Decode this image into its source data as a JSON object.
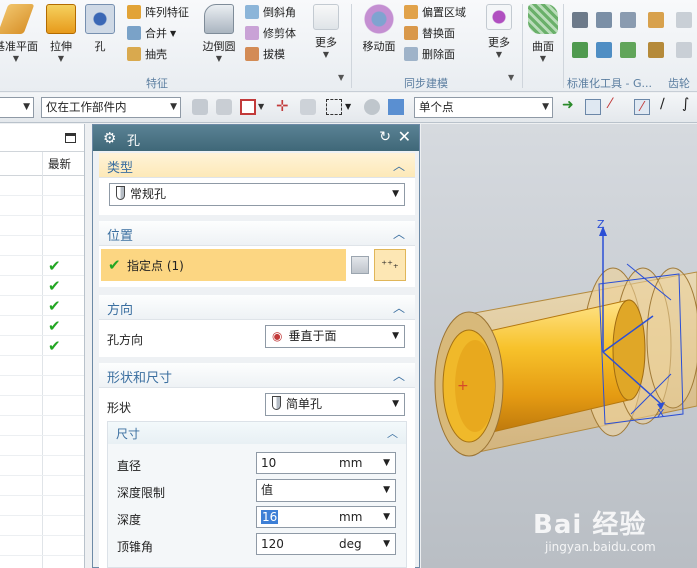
{
  "ribbon": {
    "big_buttons": [
      {
        "label": "基准平面"
      },
      {
        "label": "拉伸"
      },
      {
        "label": "孔"
      },
      {
        "label": "边倒圆"
      },
      {
        "label": "更多"
      },
      {
        "label": "移动面"
      },
      {
        "label": "更多"
      },
      {
        "label": "曲面"
      }
    ],
    "small_buttons": {
      "array_feature": "阵列特征",
      "combine": "合并",
      "shell": "抽壳",
      "chamfer": "倒斜角",
      "trim_body": "修剪体",
      "draft": "拔模",
      "offset_region": "偏置区域",
      "replace_face": "替换面",
      "delete_face": "删除面"
    },
    "groups": {
      "feature": "特征",
      "sync_modeling": "同步建模",
      "std_tools": "标准化工具 - G...",
      "gear": "齿轮"
    }
  },
  "selection_bar": {
    "filter_value": "仅在工作部件内",
    "snap_value": "单个点"
  },
  "navigator": {
    "column_header": "最新",
    "check_mark": "✔"
  },
  "dialog": {
    "title": "孔",
    "sections": {
      "type": {
        "title": "类型",
        "value": "常规孔"
      },
      "position": {
        "title": "位置",
        "specify_point": "指定点 (1)"
      },
      "direction": {
        "title": "方向",
        "label": "孔方向",
        "value": "垂直于面"
      },
      "shape": {
        "title": "形状和尺寸",
        "shape_label": "形状",
        "shape_value": "简单孔",
        "dimensions_title": "尺寸",
        "diameter_label": "直径",
        "diameter_value": "10",
        "diameter_unit": "mm",
        "depth_limit_label": "深度限制",
        "depth_limit_value": "值",
        "depth_label": "深度",
        "depth_value": "16",
        "depth_unit": "mm",
        "tip_angle_label": "顶锥角",
        "tip_angle_value": "120",
        "tip_angle_unit": "deg"
      }
    }
  },
  "viewport": {
    "axis_z": "Z",
    "axis_x": "X",
    "watermark_logo": "Bai 经验",
    "watermark_url": "jingyan.baidu.com"
  },
  "colors": {
    "dialog_title_bar": "#4b7383",
    "active_row": "#fcd682",
    "section_title": "#3b6fa0",
    "part_yellow": "#f2b21e",
    "check_green": "#23a623"
  }
}
